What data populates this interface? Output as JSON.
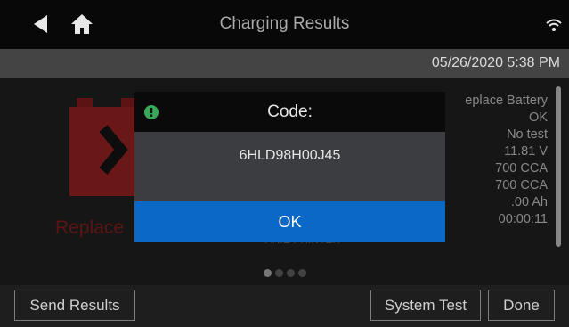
{
  "header": {
    "title": "Charging Results",
    "back_icon": "back-triangle-icon",
    "home_icon": "home-icon",
    "wifi_icon": "wifi-icon"
  },
  "datetime": "05/26/2020 5:38 PM",
  "result": {
    "status_label": "Replace",
    "values": [
      "eplace Battery",
      "OK",
      "No test",
      "11.81 V",
      "700 CCA",
      "700 CCA",
      ".00 Ah",
      "00:00:11"
    ],
    "partial_label": "ANIE PRINTER"
  },
  "pager": {
    "count": 4,
    "active": 0
  },
  "buttons": {
    "send_results": "Send Results",
    "system_test": "System Test",
    "done": "Done"
  },
  "dialog": {
    "title": "Code:",
    "code": "6HLD98H00J45",
    "ok_label": "OK"
  },
  "colors": {
    "accent": "#0b68c7",
    "alert": "#3aa85a",
    "battery_red": "#8e1e1e"
  }
}
